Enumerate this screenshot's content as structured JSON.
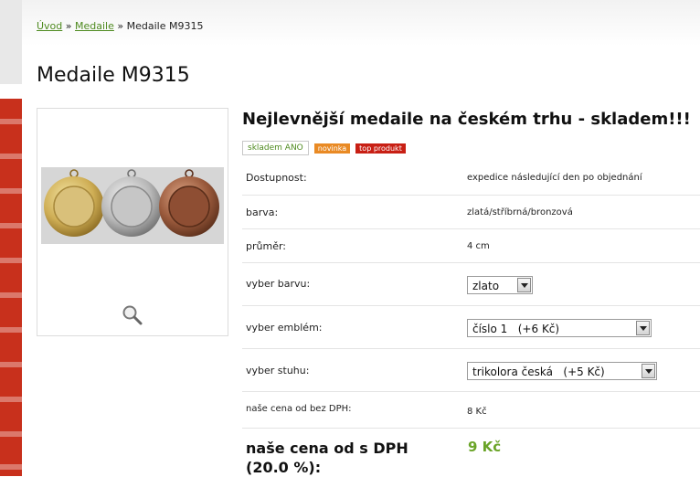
{
  "breadcrumb": {
    "home": "Úvod",
    "sep1": "»",
    "category": "Medaile",
    "sep2": "»",
    "current": "Medaile M9315"
  },
  "product": {
    "title": "Medaile M9315",
    "subtitle": "Nejlevnější medaile na českém trhu - skladem!!!",
    "badges": {
      "stock": "skladem ANO",
      "new": "novinka",
      "top": "top produkt"
    },
    "colors": {
      "accent_green": "#4e8a1f",
      "price_green": "#6aa428",
      "badge_orange": "#e98a24",
      "badge_red": "#c81f14",
      "strip_red": "#c8301c"
    }
  },
  "specs": {
    "availability": {
      "label": "Dostupnost:",
      "value": "expedice následující den po objednání"
    },
    "color": {
      "label": "barva:",
      "value": "zlatá/stříbrná/bronzová"
    },
    "diameter": {
      "label": "průměr:",
      "value": "4 cm"
    }
  },
  "options": {
    "color": {
      "label": "vyber barvu:",
      "selected": "zlato"
    },
    "emblem": {
      "label": "vyber emblém:",
      "selected": "číslo 1   (+6 Kč)"
    },
    "ribbon": {
      "label": "vyber stuhu:",
      "selected": "trikolora česká   (+5 Kč)"
    }
  },
  "price": {
    "net_label": "naše cena od bez DPH:",
    "net_value": "8 Kč",
    "gross_label": "naše cena od s DPH (20.0 %):",
    "gross_value": "9 Kč"
  }
}
